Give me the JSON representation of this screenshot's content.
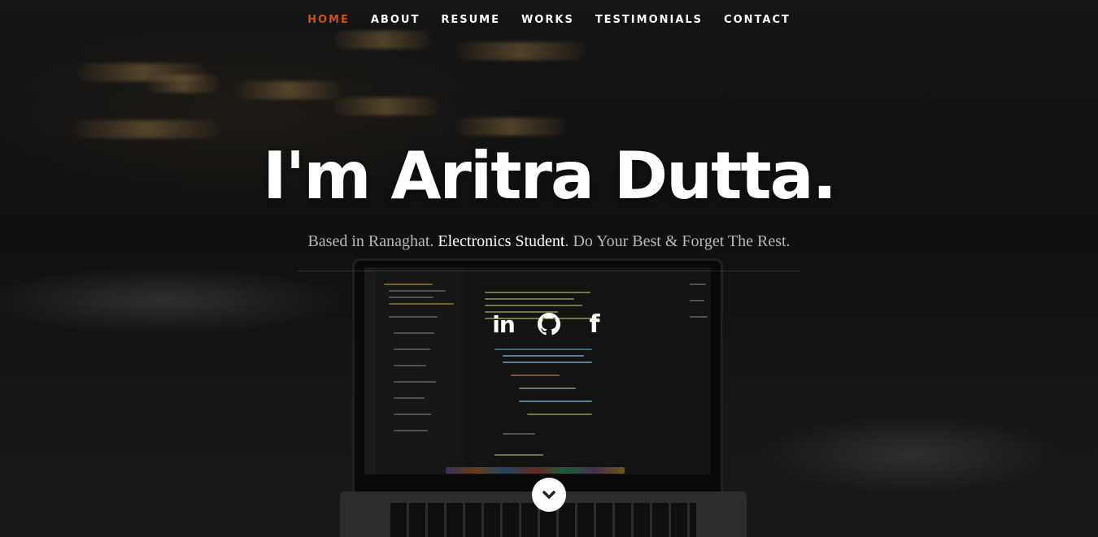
{
  "nav": {
    "items": [
      {
        "label": "HOME",
        "active": true
      },
      {
        "label": "ABOUT",
        "active": false
      },
      {
        "label": "RESUME",
        "active": false
      },
      {
        "label": "WORKS",
        "active": false
      },
      {
        "label": "TESTIMONIALS",
        "active": false
      },
      {
        "label": "CONTACT",
        "active": false
      }
    ]
  },
  "hero": {
    "title": "I'm Aritra Dutta.",
    "tagline_prefix": "Based in Ranaghat. ",
    "tagline_highlight": "Electronics Student",
    "tagline_suffix": ". Do Your Best & Forget The Rest.",
    "social": [
      {
        "icon": "linkedin-icon",
        "glyph": "in"
      },
      {
        "icon": "github-icon"
      },
      {
        "icon": "facebook-icon",
        "glyph": "f"
      }
    ],
    "scroll_icon": "chevron-down-icon"
  },
  "colors": {
    "accent": "#d35400",
    "text": "#ffffff",
    "tagline": "#b7b7b7"
  }
}
